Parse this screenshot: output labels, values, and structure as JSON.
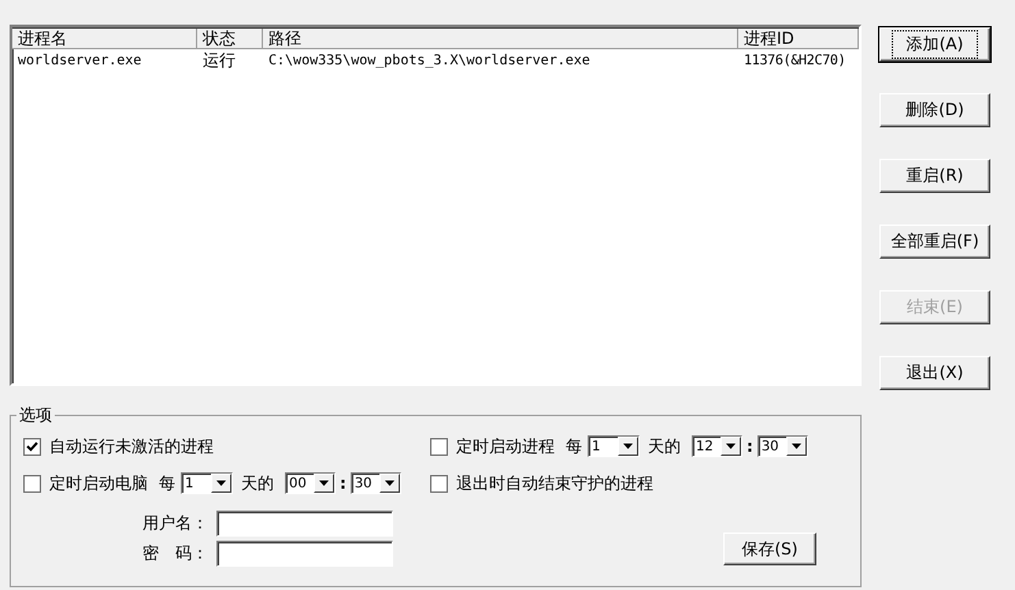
{
  "process_list": {
    "columns": [
      "进程名",
      "状态",
      "路径",
      "进程ID"
    ],
    "rows": [
      {
        "cells": [
          "worldserver.exe",
          "运行",
          "C:\\wow335\\wow_pbots_3.X\\worldserver.exe",
          "11376(&H2C70)"
        ]
      }
    ]
  },
  "buttons": [
    {
      "label": "添加(A)",
      "focused": true,
      "disabled": false
    },
    {
      "label": "删除(D)",
      "focused": false,
      "disabled": false
    },
    {
      "label": "重启(R)",
      "focused": false,
      "disabled": false
    },
    {
      "label": "全部重启(F)",
      "focused": false,
      "disabled": false
    },
    {
      "label": "结束(E)",
      "focused": false,
      "disabled": true
    },
    {
      "label": "退出(X)",
      "focused": false,
      "disabled": false
    }
  ],
  "options": {
    "title": "选项",
    "auto_run": {
      "label": "自动运行未激活的进程",
      "checked": true
    },
    "timed_process": {
      "label": "定时启动进程",
      "checked": false,
      "every": "每",
      "day": "1",
      "days_of": "天的",
      "hour": "12",
      "separator": ":",
      "minute": "30"
    },
    "timed_computer": {
      "label": "定时启动电脑",
      "checked": false,
      "every": "每",
      "day": "1",
      "days_of": "天的",
      "hour": "00",
      "separator": ":",
      "minute": "30"
    },
    "exit_stop": {
      "label": "退出时自动结束守护的进程",
      "checked": false
    },
    "username": {
      "label": "用户名："
    },
    "password": {
      "label": "密　码："
    },
    "save_button": "保存(S)"
  }
}
